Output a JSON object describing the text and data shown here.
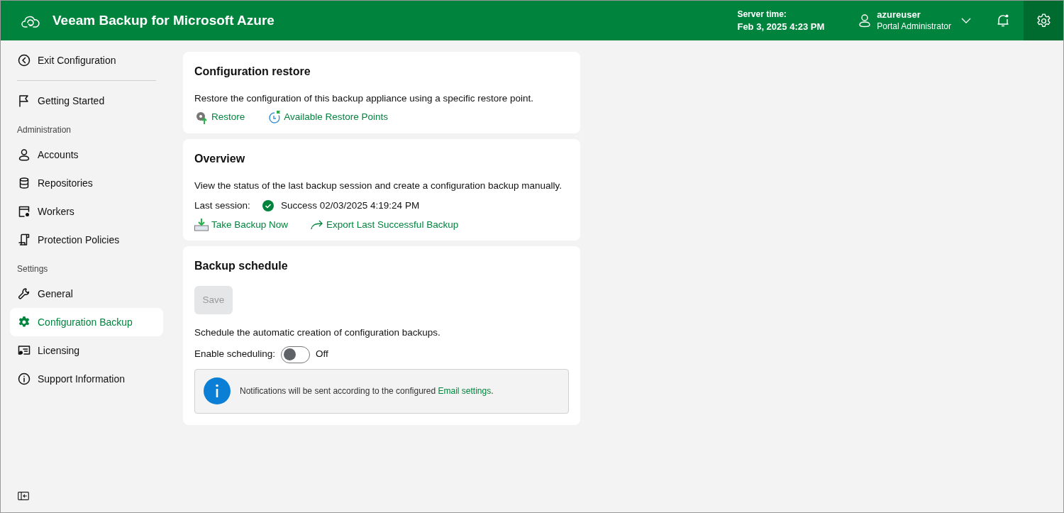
{
  "header": {
    "title": "Veeam Backup for Microsoft Azure",
    "server_time_label": "Server time:",
    "server_time": "Feb 3, 2025 4:23 PM",
    "user": {
      "name": "azureuser",
      "role": "Portal Administrator"
    },
    "notifications": true,
    "settings_selected": true
  },
  "sidebar": {
    "items": [
      {
        "kind": "item",
        "label": "Exit Configuration",
        "selected": false
      },
      {
        "kind": "divider"
      },
      {
        "kind": "item",
        "label": "Getting Started",
        "selected": false
      },
      {
        "kind": "section",
        "label": "Administration"
      },
      {
        "kind": "item",
        "label": "Accounts",
        "selected": false
      },
      {
        "kind": "item",
        "label": "Repositories",
        "selected": false
      },
      {
        "kind": "item",
        "label": "Workers",
        "selected": false
      },
      {
        "kind": "item",
        "label": "Protection Policies",
        "selected": false
      },
      {
        "kind": "section",
        "label": "Settings"
      },
      {
        "kind": "item",
        "label": "General",
        "selected": false
      },
      {
        "kind": "item",
        "label": "Configuration Backup",
        "selected": true
      },
      {
        "kind": "item",
        "label": "Licensing",
        "selected": false
      },
      {
        "kind": "item",
        "label": "Support Information",
        "selected": false
      }
    ]
  },
  "restore": {
    "title": "Configuration restore",
    "description": "Restore the configuration of this backup appliance using a specific restore point.",
    "actions": [
      "Restore",
      "Available Restore Points"
    ]
  },
  "overview": {
    "title": "Overview",
    "description": "View the status of the last backup session and create a configuration backup manually.",
    "last_session_label": "Last session:",
    "last_session": "Success 02/03/2025 4:19:24 PM",
    "actions": [
      "Take Backup Now",
      "Export Last Successful Backup"
    ]
  },
  "schedule": {
    "title": "Backup schedule",
    "save": {
      "label": "Save",
      "disabled": true
    },
    "description": "Schedule the automatic creation of configuration backups.",
    "toggle_label": "Enable scheduling:",
    "toggle": {
      "on": false,
      "state_label": "Off"
    },
    "note": {
      "text": "Notifications will be sent according to the configured ",
      "link": "Email settings",
      "after": "."
    }
  }
}
